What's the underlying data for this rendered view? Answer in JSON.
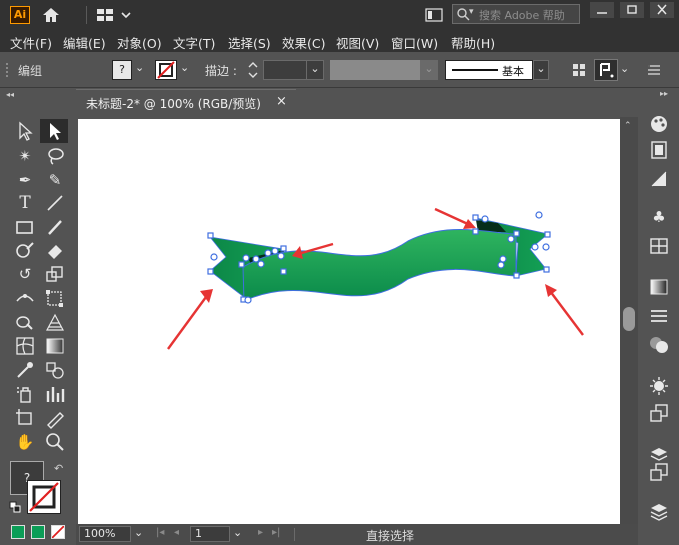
{
  "app": {
    "logo": "Ai",
    "home_icon": "home-icon",
    "workspace_icon": "layout-icon"
  },
  "search": {
    "placeholder": "搜索 Adobe 帮助"
  },
  "window_controls": {
    "minimize": "minimize-icon",
    "maximize": "maximize-icon",
    "close": "close-icon"
  },
  "menus": [
    {
      "label": "文件(F)"
    },
    {
      "label": "编辑(E)"
    },
    {
      "label": "对象(O)"
    },
    {
      "label": "文字(T)"
    },
    {
      "label": "选择(S)"
    },
    {
      "label": "效果(C)"
    },
    {
      "label": "视图(V)"
    },
    {
      "label": "窗口(W)"
    },
    {
      "label": "帮助(H)"
    }
  ],
  "controlbar": {
    "mode_label": "编组",
    "fill_swatch": "?",
    "stroke_label": "描边 :",
    "stroke_value": "",
    "brush_label": "基本"
  },
  "document": {
    "tab_title": "未标题-2* @ 100% (RGB/预览)",
    "tab_close": "×"
  },
  "statusbar": {
    "zoom": "100%",
    "artboard_number": "1",
    "current_tool": "直接选择"
  },
  "colors": {
    "ribbon_dark": "#0a8a4a",
    "ribbon_light": "#2fb45f",
    "selection": "#3f6fe0",
    "arrow": "#e63434",
    "fill_swatch": "#0b9d57"
  }
}
